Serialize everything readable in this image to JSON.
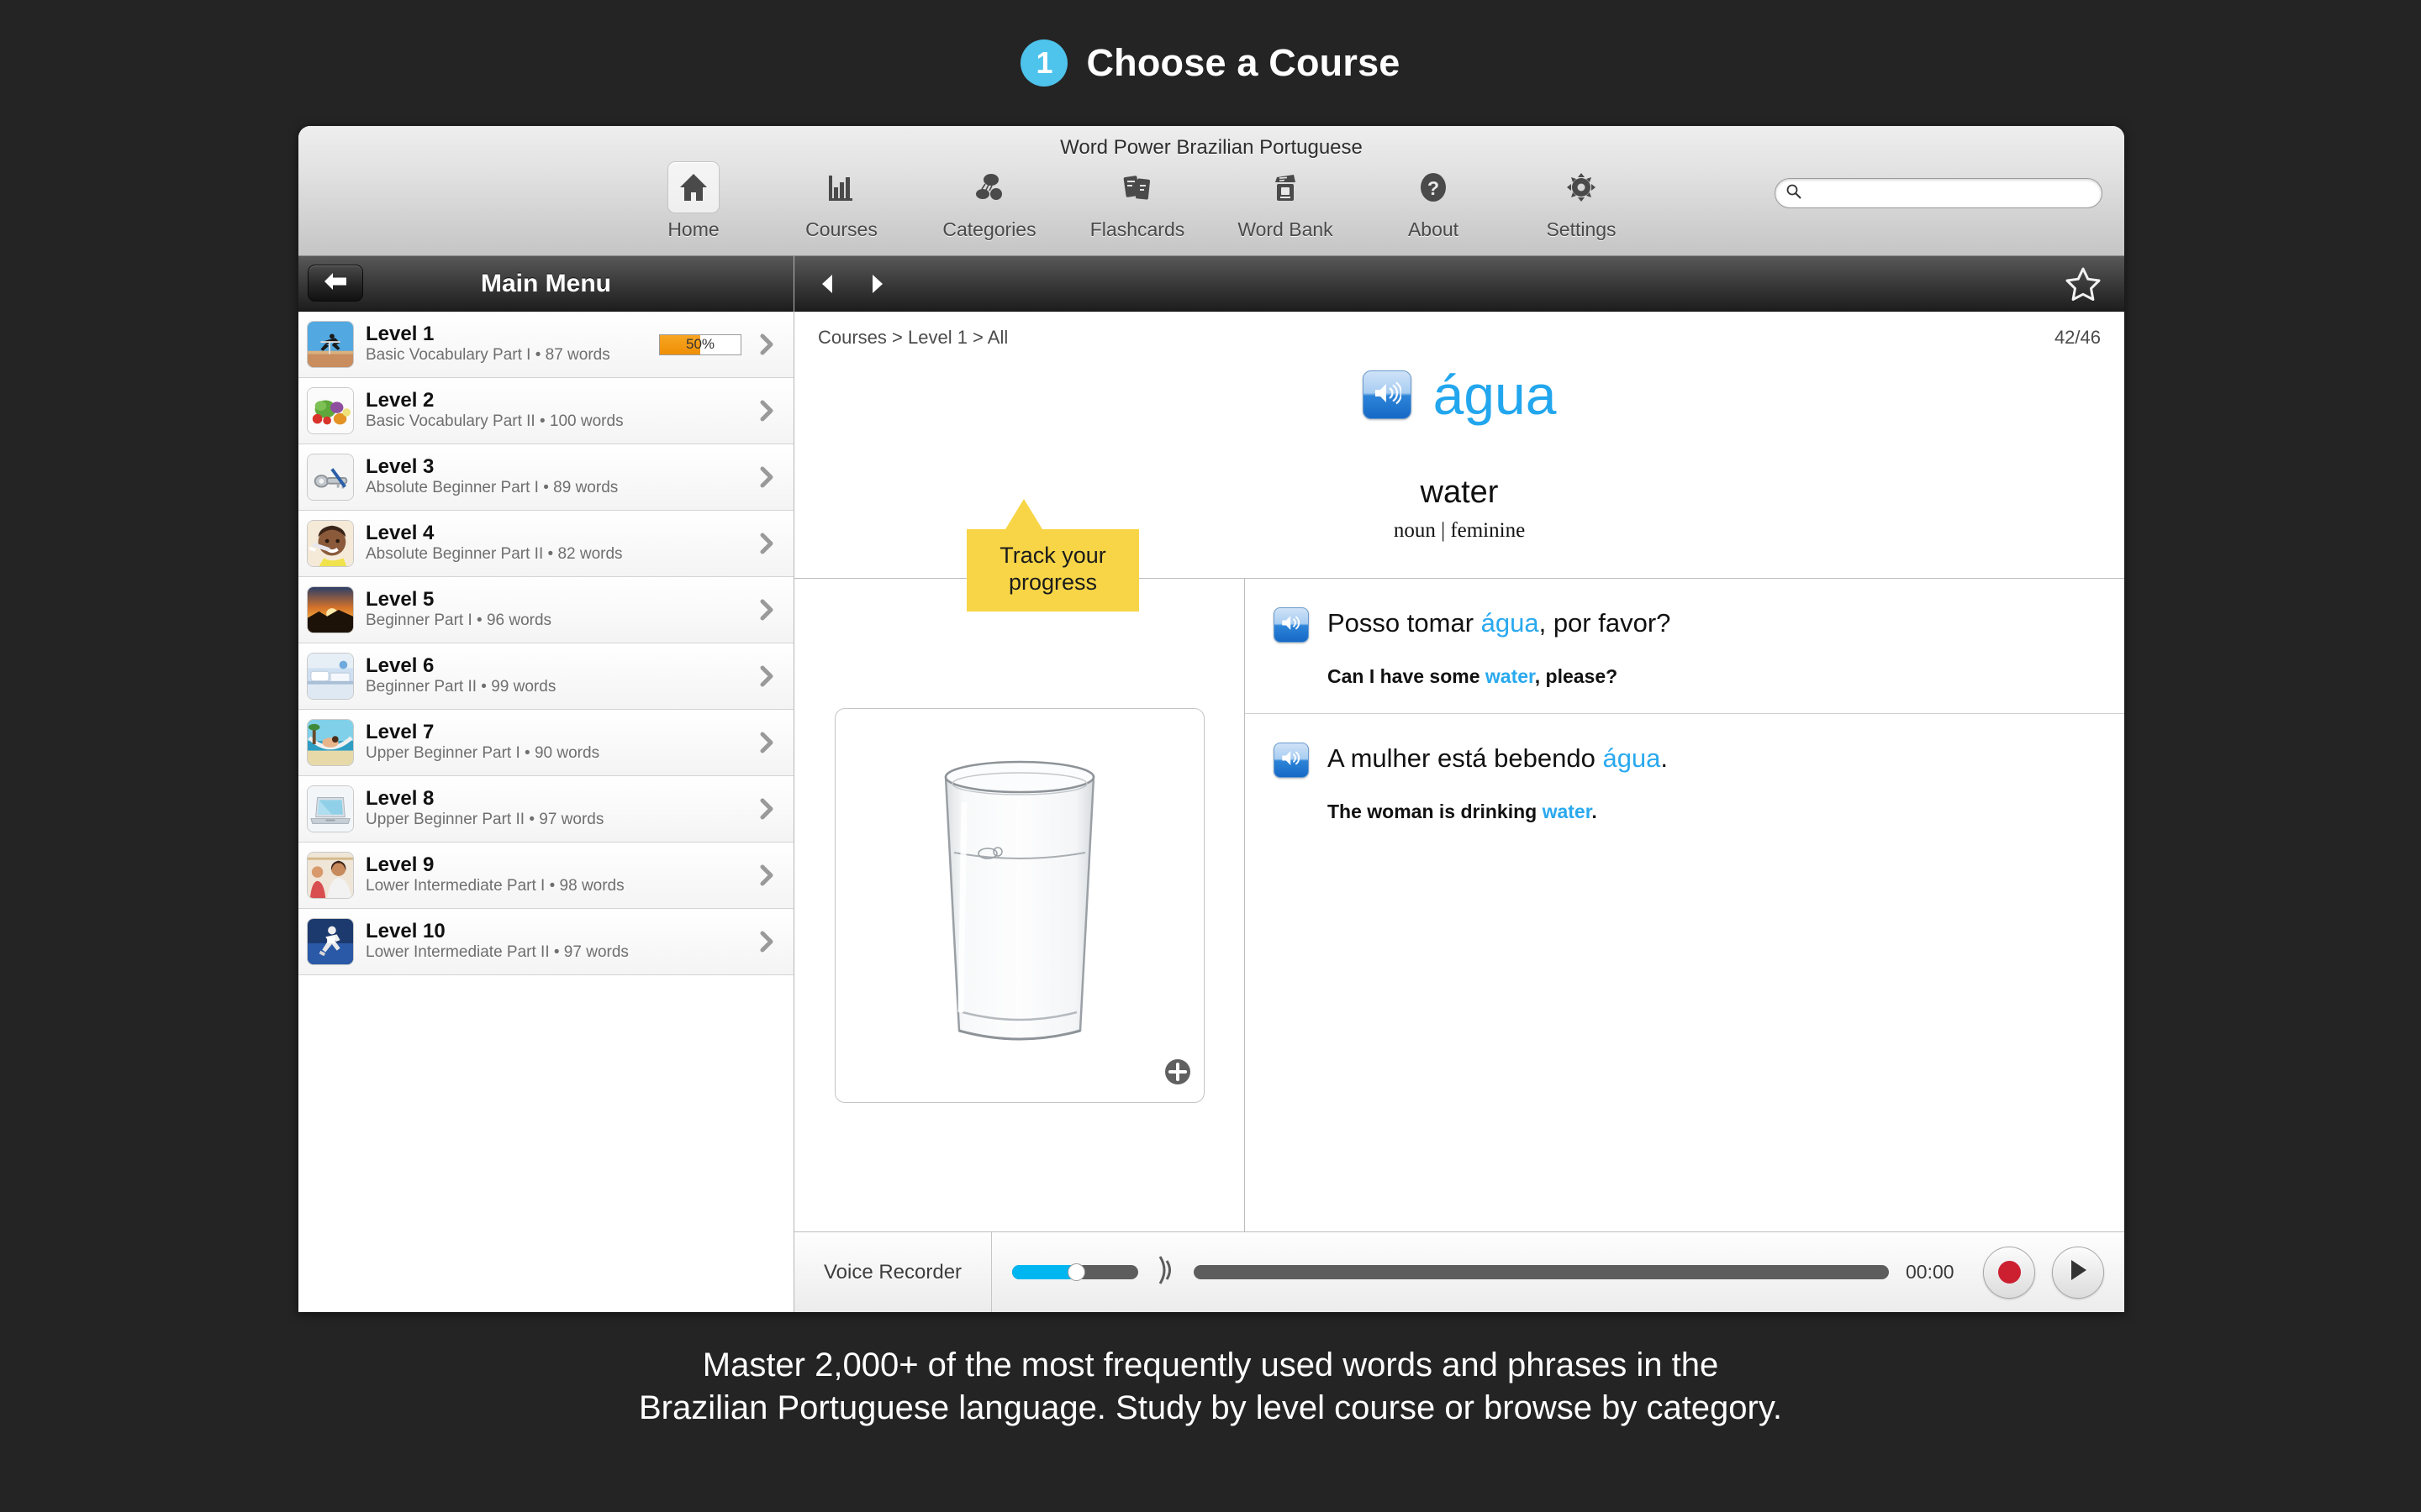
{
  "promo": {
    "step_number": "1",
    "title": "Choose a Course",
    "badge_color": "#4ec3ec",
    "caption_line1": "Master 2,000+ of the most frequently used words and phrases in the",
    "caption_line2": "Brazilian Portuguese language. Study by level course or browse by category."
  },
  "window": {
    "title": "Word Power Brazilian Portuguese"
  },
  "toolbar": {
    "items": [
      {
        "label": "Home",
        "icon": "home-icon",
        "selected": true
      },
      {
        "label": "Courses",
        "icon": "bar-chart-icon",
        "selected": false
      },
      {
        "label": "Categories",
        "icon": "categories-icon",
        "selected": false
      },
      {
        "label": "Flashcards",
        "icon": "flashcards-icon",
        "selected": false
      },
      {
        "label": "Word Bank",
        "icon": "word-bank-icon",
        "selected": false
      },
      {
        "label": "About",
        "icon": "question-mark-icon",
        "selected": false
      },
      {
        "label": "Settings",
        "icon": "gear-icon",
        "selected": false
      }
    ],
    "search_placeholder": "",
    "search_value": ""
  },
  "sidebar": {
    "title": "Main Menu",
    "back_icon": "back-arrow-icon",
    "levels": [
      {
        "name": "Level 1",
        "subtitle": "Basic Vocabulary Part I • 87 words",
        "progress": "50%",
        "progress_value": 50,
        "thumb": "hurdler-thumb"
      },
      {
        "name": "Level 2",
        "subtitle": "Basic Vocabulary Part II • 100 words",
        "progress": "",
        "progress_value": null,
        "thumb": "vegetables-thumb"
      },
      {
        "name": "Level 3",
        "subtitle": "Absolute Beginner Part I • 89 words",
        "progress": "",
        "progress_value": null,
        "thumb": "keys-thumb"
      },
      {
        "name": "Level 4",
        "subtitle": "Absolute Beginner Part II • 82 words",
        "progress": "",
        "progress_value": null,
        "thumb": "toothbrush-thumb"
      },
      {
        "name": "Level 5",
        "subtitle": "Beginner Part I • 96 words",
        "progress": "",
        "progress_value": null,
        "thumb": "sunset-thumb"
      },
      {
        "name": "Level 6",
        "subtitle": "Beginner Part II • 99 words",
        "progress": "",
        "progress_value": null,
        "thumb": "bed-thumb"
      },
      {
        "name": "Level 7",
        "subtitle": "Upper Beginner Part I • 90 words",
        "progress": "",
        "progress_value": null,
        "thumb": "hammock-thumb"
      },
      {
        "name": "Level 8",
        "subtitle": "Upper Beginner Part II • 97 words",
        "progress": "",
        "progress_value": null,
        "thumb": "laptop-thumb"
      },
      {
        "name": "Level 9",
        "subtitle": "Lower Intermediate Part I • 98 words",
        "progress": "",
        "progress_value": null,
        "thumb": "people-thumb"
      },
      {
        "name": "Level 10",
        "subtitle": "Lower Intermediate Part II • 97 words",
        "progress": "",
        "progress_value": null,
        "thumb": "runner-thumb"
      }
    ]
  },
  "tooltip": {
    "text": "Track your progress",
    "background": "#f7d547"
  },
  "content": {
    "nav": {
      "prev_icon": "prev-arrow-icon",
      "next_icon": "next-arrow-icon",
      "star_icon": "star-outline-icon"
    },
    "breadcrumb": "Courses > Level 1 > All",
    "counter": "42/46",
    "headword": "água",
    "headword_color": "#22a6ee",
    "translation": "water",
    "part_of_speech": "noun | feminine",
    "image": {
      "alt": "glass-of-water",
      "zoom_icon": "plus-zoom-icon"
    },
    "sentences": [
      {
        "target_prefix": "Posso tomar ",
        "target_highlight": "água",
        "target_suffix": ", por favor?",
        "native_prefix": "Can I have some ",
        "native_highlight": "water",
        "native_suffix": ", please?"
      },
      {
        "target_prefix": "A mulher está bebendo ",
        "target_highlight": "água",
        "target_suffix": ".",
        "native_prefix": "The woman is drinking ",
        "native_highlight": "water",
        "native_suffix": "."
      }
    ]
  },
  "recorder": {
    "label": "Voice Recorder",
    "time": "00:00",
    "volume_percent": 48,
    "progress_percent": 0,
    "record_icon": "record-circle-icon",
    "play_icon": "play-triangle-icon",
    "accent_color": "#00b6f0",
    "record_color": "#cc2031"
  }
}
